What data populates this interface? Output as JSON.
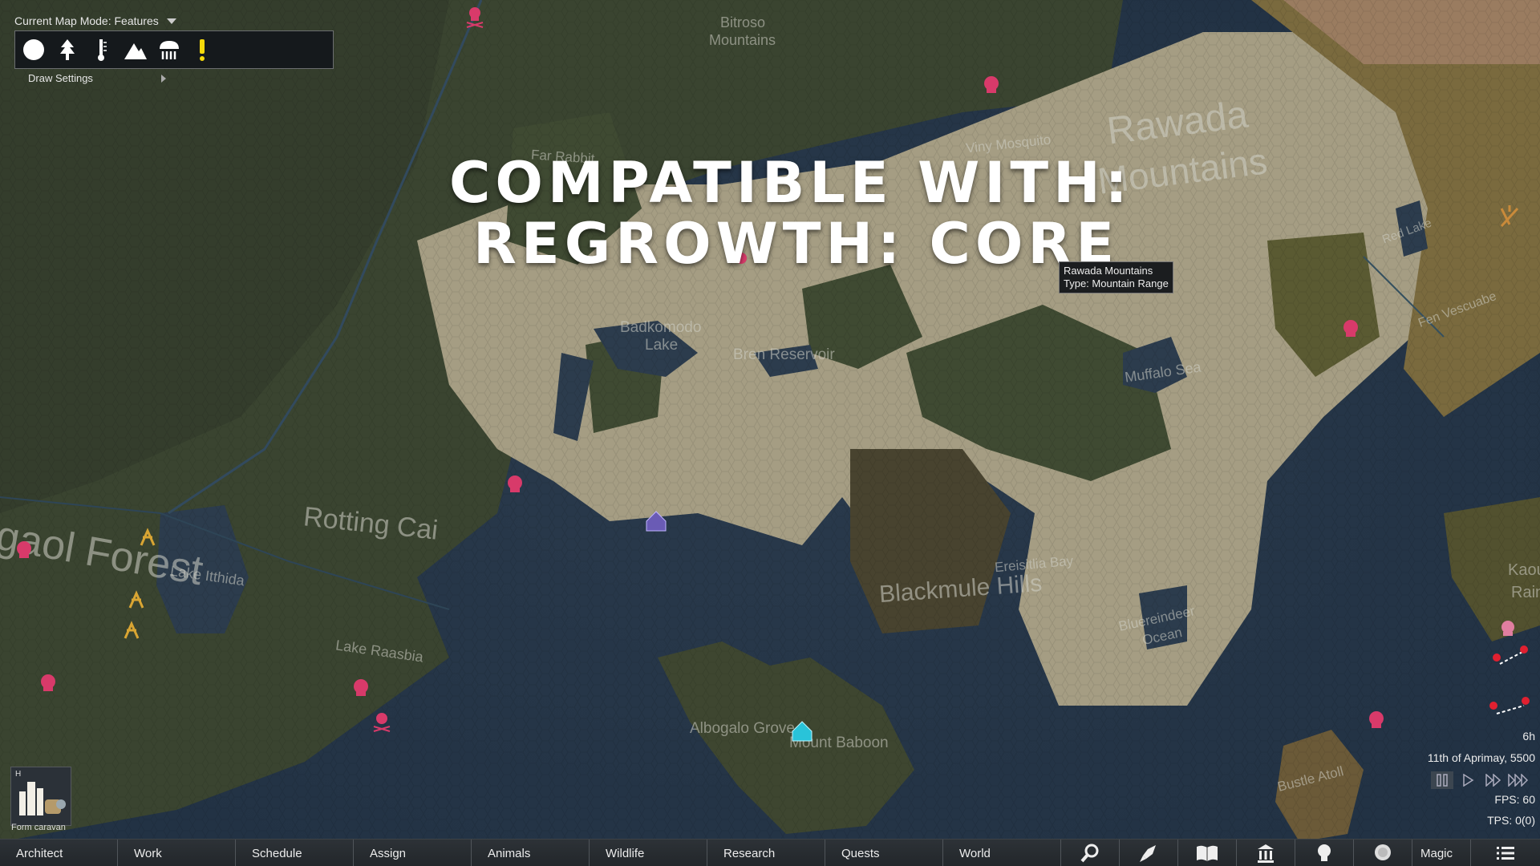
{
  "map_mode": {
    "label": "Current Map Mode: Features"
  },
  "draw_settings": {
    "label": "Draw Settings"
  },
  "toolbar_icons": [
    "circle-icon",
    "tree-icon",
    "thermometer-icon",
    "mountain-icon",
    "rain-icon",
    "exclamation-icon"
  ],
  "headline": {
    "line1": "COMPATIBLE WITH:",
    "line2": "REGROWTH: CORE"
  },
  "tooltip": {
    "line1": "Rawada Mountains",
    "line2": "Type: Mountain Range"
  },
  "map_labels": {
    "bitroso": "Bitroso",
    "bitroso_2": "Mountains",
    "far_rabbit": "Far Rabbit",
    "viny_mosquito": "Viny Mosquito",
    "rawada": "Rawada",
    "rawada_2": "Mountains",
    "red_lake": "Red Lake",
    "fen_vescuabe": "Fen Vescuabe",
    "badkomodo": "Badkomodo",
    "badkomodo_2": "Lake",
    "bren_reservoir": "Bren Reservoir",
    "muffalo_sea": "Muffalo Sea",
    "rotting_cai": "Rotting Cai",
    "forest": "gaol Forest",
    "lake_itthida": "Lake Itthida",
    "ereisitlia_bay": "Ereisitlia Bay",
    "blackmule_hills": "Blackmule Hills",
    "bluereindeer": "Bluereindeer",
    "bluereindeer_2": "Ocean",
    "lake_raasbia": "Lake Raasbia",
    "albogalo_grove": "Albogalo Grove",
    "mount_baboon": "Mount Baboon",
    "bustle_atoll": "Bustle Atoll",
    "kaou": "Kaou",
    "rain": "Rain"
  },
  "caravan": {
    "hotkey": "H",
    "label": "Form caravan"
  },
  "time": {
    "hours": "6h",
    "date": "11th of Aprimay, 5500",
    "fps": "FPS: 60",
    "tps": "TPS: 0(0)"
  },
  "speed_controls": [
    "pause-icon",
    "play-icon",
    "fast-forward-icon",
    "superfast-icon"
  ],
  "bottom_tabs": [
    "Architect",
    "Work",
    "Schedule",
    "Assign",
    "Animals",
    "Wildlife",
    "Research",
    "Quests",
    "World"
  ],
  "bottom_icon_tabs": [
    "search-icon",
    "rocket-icon",
    "book-icon",
    "factions-icon",
    "lightbulb-icon",
    "psycast-icon"
  ],
  "magic_tab": "Magic",
  "colors": {
    "water": "#2c3c4d",
    "forest": "#3f4a32",
    "mountain": "#a59d83",
    "hostile": "#d83a6a",
    "player": "#29c3d9",
    "ally": "#6a5bb5",
    "gold": "#d9a533"
  }
}
